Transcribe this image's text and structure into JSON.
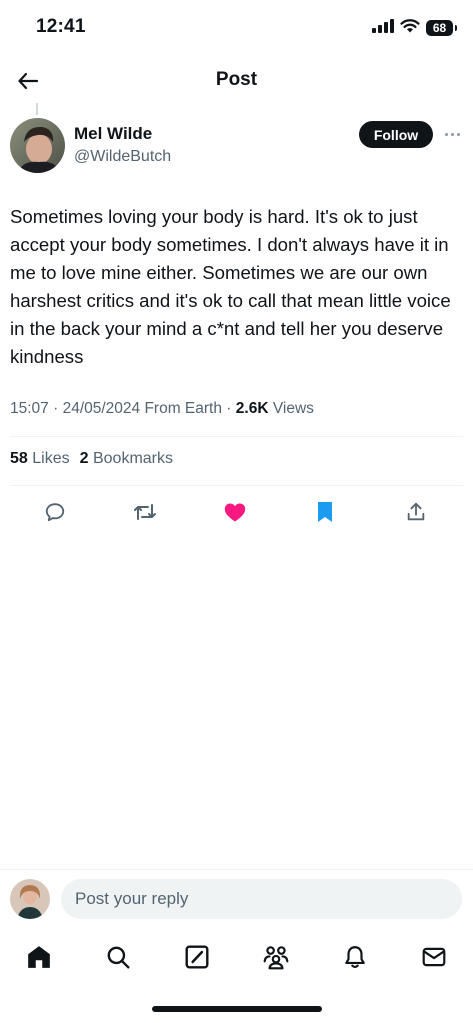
{
  "status_bar": {
    "time": "12:41",
    "battery": "68"
  },
  "header": {
    "title": "Post"
  },
  "post": {
    "author_name": "Mel Wilde",
    "author_handle": "@WildeButch",
    "follow_label": "Follow",
    "text": "Sometimes loving your body is hard. It's ok to just accept your body sometimes. I don't always have it in me to love mine either. Sometimes we are our own harshest critics and it's ok to call that mean little voice in the back your mind a c*nt and tell her you deserve kindness",
    "time": "15:07",
    "date": "24/05/2024",
    "source": "From Earth",
    "views_count": "2.6K",
    "views_label": "Views",
    "likes_count": "58",
    "likes_label": "Likes",
    "bookmarks_count": "2",
    "bookmarks_label": "Bookmarks"
  },
  "actions": {
    "reply_icon": "reply-icon",
    "repost_icon": "repost-icon",
    "like_icon": "heart-filled-icon",
    "bookmark_icon": "bookmark-filled-icon",
    "share_icon": "share-icon"
  },
  "reply_bar": {
    "placeholder": "Post your reply"
  },
  "tabbar": {
    "items": [
      "home-icon",
      "search-icon",
      "grok-icon",
      "communities-icon",
      "notifications-icon",
      "messages-icon"
    ]
  },
  "colors": {
    "text": "#0f1419",
    "secondary": "#536471",
    "like": "#f91880",
    "bookmark": "#1d9bf0",
    "divider": "#eff3f4"
  }
}
